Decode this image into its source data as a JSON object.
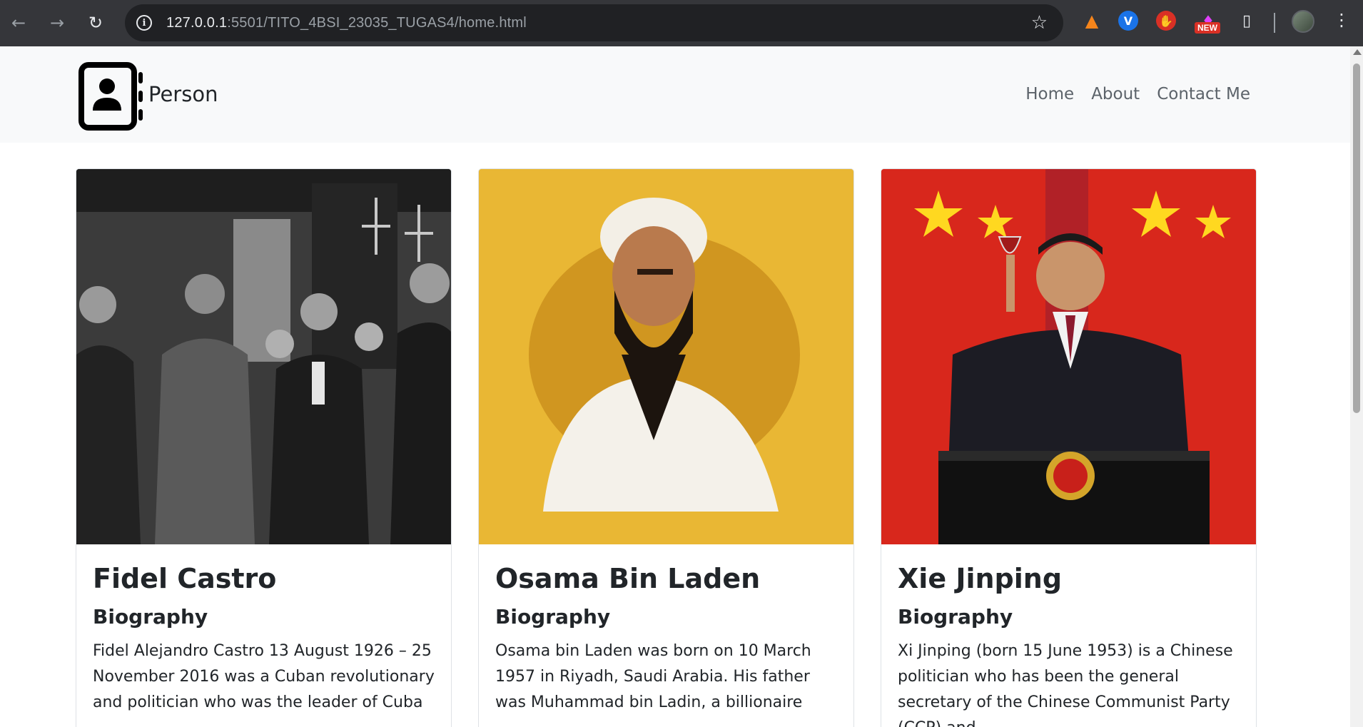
{
  "browser": {
    "url_host": "127.0.0.1",
    "url_path": ":5501/TITO_4BSI_23035_TUGAS4/home.html",
    "new_badge": "NEW",
    "ext_v_label": "V"
  },
  "navbar": {
    "brand": "Person",
    "links": [
      "Home",
      "About",
      "Contact Me"
    ]
  },
  "cards": [
    {
      "title": "Fidel Castro",
      "subtitle": "Biography",
      "text": "Fidel Alejandro Castro 13 August 1926 – 25 November 2016 was a Cuban revolutionary and politician who was the leader of Cuba"
    },
    {
      "title": "Osama Bin Laden",
      "subtitle": "Biography",
      "text": "Osama bin Laden was born on 10 March 1957 in Riyadh, Saudi Arabia. His father was Muhammad bin Ladin, a billionaire"
    },
    {
      "title": "Xie Jinping",
      "subtitle": "Biography",
      "text": "Xi Jinping (born 15 June 1953) is a Chinese politician who has been the general secretary of the Chinese Communist Party (CCP) and"
    }
  ],
  "colors": {
    "chrome_bg": "#35363a",
    "navbar_bg": "#f8f9fa",
    "card1_bg": "#3a3a3a",
    "card2_bg": "#e9b734",
    "card3_bg": "#d8271c"
  }
}
